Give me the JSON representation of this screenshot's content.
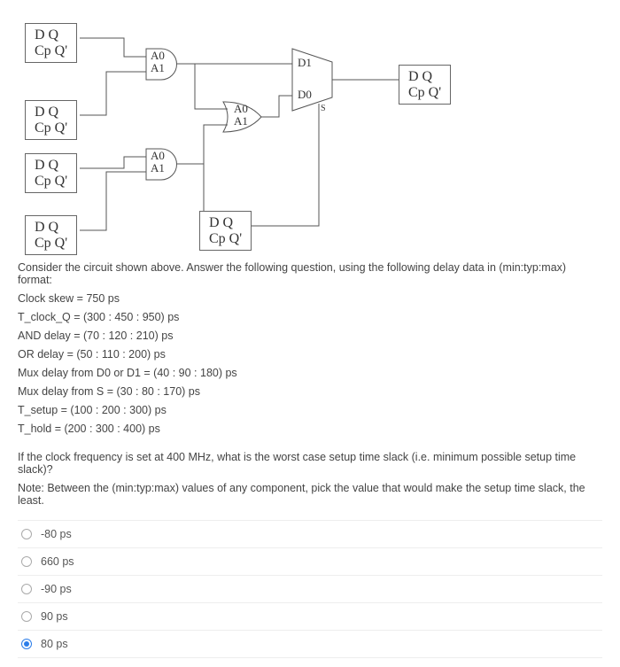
{
  "circuit": {
    "ff_labels": {
      "line1": "D  Q",
      "line2": "Cp Q'"
    },
    "gate1": {
      "a0": "A0",
      "a1": "A1"
    },
    "gate2": {
      "a0": "A0",
      "a1": "A1"
    },
    "gate3": {
      "a0": "A0",
      "a1": "A1"
    },
    "mux": {
      "d1": "D1",
      "d0": "D0",
      "s": "S"
    }
  },
  "problem": {
    "intro": "Consider the circuit shown above. Answer the following question, using the following delay data in (min:typ:max) format:",
    "skew": "Clock skew = 750 ps",
    "tclockq": "T_clock_Q = (300 : 450 : 950) ps",
    "and": "AND delay = (70 : 120 : 210) ps",
    "or": "OR delay = (50 : 110 : 200) ps",
    "muxd": "Mux delay from D0 or D1 = (40 : 90 : 180) ps",
    "muxs": "Mux delay from S = (30 : 80 : 170) ps",
    "tsetup": "T_setup = (100 : 200 : 300) ps",
    "thold": "T_hold = (200 : 300 : 400) ps"
  },
  "question": {
    "q": "If the clock frequency is set at 400 MHz, what is the worst case setup time slack (i.e. minimum possible setup time slack)?",
    "note": "Note: Between the (min:typ:max) values of any component, pick the value that would make the setup time slack, the least."
  },
  "options": [
    {
      "label": "-80 ps",
      "selected": false
    },
    {
      "label": "660 ps",
      "selected": false
    },
    {
      "label": "-90 ps",
      "selected": false
    },
    {
      "label": "90 ps",
      "selected": false
    },
    {
      "label": "80 ps",
      "selected": true
    }
  ]
}
